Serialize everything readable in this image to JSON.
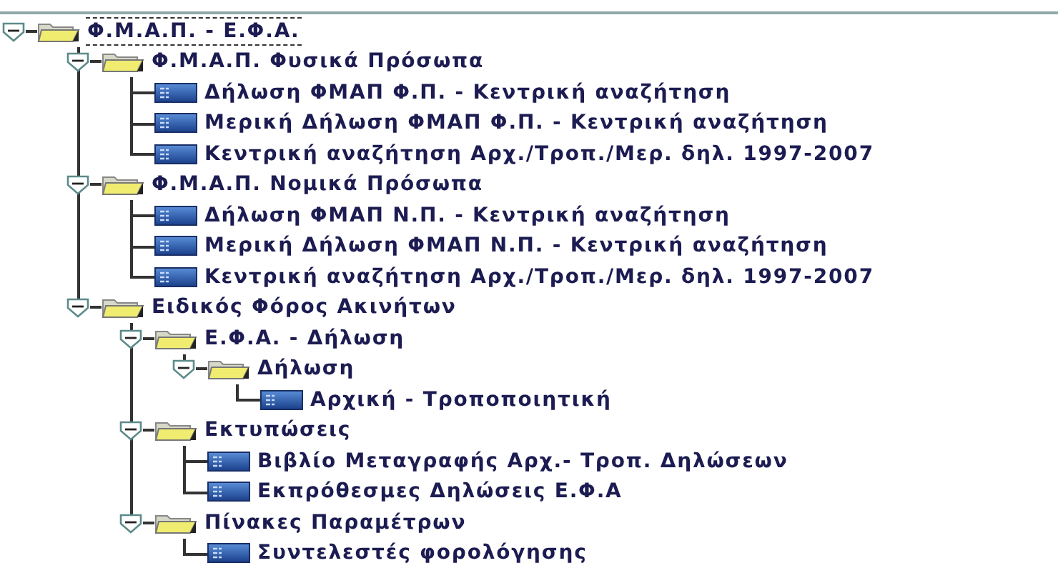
{
  "tree": [
    {
      "label": "Φ.Μ.Α.Π. - Ε.Φ.Α.",
      "kind": "folder",
      "expanded": true,
      "selected": true,
      "children": [
        {
          "label": "Φ.Μ.Α.Π. Φυσικά Πρόσωπα",
          "kind": "folder",
          "expanded": true,
          "selected": false,
          "children": [
            {
              "label": "Δήλωση ΦΜΑΠ Φ.Π. - Κεντρική αναζήτηση",
              "kind": "leaf",
              "selected": false
            },
            {
              "label": "Μερική Δήλωση ΦΜΑΠ Φ.Π. - Κεντρική αναζήτηση",
              "kind": "leaf",
              "selected": false
            },
            {
              "label": "Κεντρική αναζήτηση Αρχ./Τροπ./Μερ. δηλ. 1997-2007",
              "kind": "leaf",
              "selected": false
            }
          ]
        },
        {
          "label": "Φ.Μ.Α.Π. Νομικά Πρόσωπα",
          "kind": "folder",
          "expanded": true,
          "selected": false,
          "children": [
            {
              "label": "Δήλωση ΦΜΑΠ Ν.Π. - Κεντρική αναζήτηση",
              "kind": "leaf",
              "selected": false
            },
            {
              "label": "Μερική Δήλωση ΦΜΑΠ Ν.Π. - Κεντρική αναζήτηση",
              "kind": "leaf",
              "selected": false
            },
            {
              "label": "Κεντρική αναζήτηση Αρχ./Τροπ./Μερ. δηλ. 1997-2007",
              "kind": "leaf",
              "selected": false
            }
          ]
        },
        {
          "label": "Ειδικός Φόρος  Ακινήτων",
          "kind": "folder",
          "expanded": true,
          "selected": false,
          "children": [
            {
              "label": "Ε.Φ.Α. - Δήλωση",
              "kind": "folder",
              "expanded": true,
              "selected": false,
              "children": [
                {
                  "label": "Δήλωση",
                  "kind": "folder",
                  "expanded": true,
                  "selected": false,
                  "children": [
                    {
                      "label": "Αρχική - Τροποποιητική",
                      "kind": "leaf",
                      "selected": false
                    }
                  ]
                }
              ]
            },
            {
              "label": "Εκτυπώσεις",
              "kind": "folder",
              "expanded": true,
              "selected": false,
              "children": [
                {
                  "label": "Βιβλίο Μεταγραφής Αρχ.- Τροπ. Δηλώσεων",
                  "kind": "leaf",
                  "selected": false
                },
                {
                  "label": "Εκπρόθεσμες Δηλώσεις Ε.Φ.Α",
                  "kind": "leaf",
                  "selected": false
                }
              ]
            },
            {
              "label": "Πίνακες Παραμέτρων",
              "kind": "folder",
              "expanded": true,
              "selected": false,
              "children": [
                {
                  "label": "Συντελεστές φορολόγησης",
                  "kind": "leaf",
                  "selected": false
                }
              ]
            }
          ]
        }
      ]
    }
  ]
}
